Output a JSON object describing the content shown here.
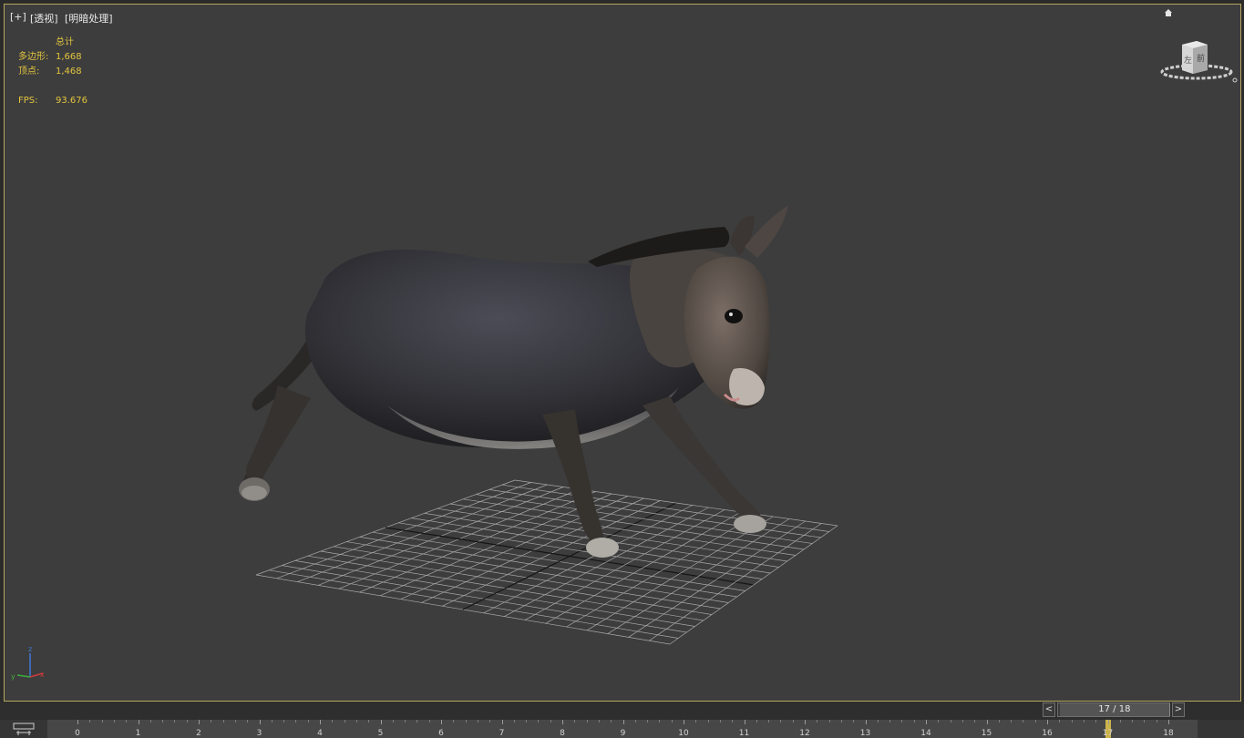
{
  "viewport": {
    "labels": [
      "[+]",
      "[透视]",
      "[明暗处理]"
    ],
    "stats": {
      "header": "总计",
      "polygons_label": "多边形:",
      "polygons_value": "1,668",
      "vertices_label": "顶点:",
      "vertices_value": "1,468",
      "fps_label": "FPS:",
      "fps_value": "93.676"
    },
    "viewcube": {
      "front_face": "左",
      "side_face": "前"
    },
    "axis_gizmo": {
      "x": "x",
      "y": "y",
      "z": "z"
    }
  },
  "time_slider": {
    "prev_label": "<",
    "next_label": ">",
    "current_frame": 17,
    "total_frames": 18,
    "display": "17 / 18"
  },
  "trackbar": {
    "frame_labels": [
      "0",
      "1",
      "2",
      "3",
      "4",
      "5",
      "6",
      "7",
      "8",
      "9",
      "10",
      "11",
      "12",
      "13",
      "14",
      "15",
      "16",
      "17",
      "18"
    ],
    "key_frame": 17
  },
  "colors": {
    "viewport_bg": "#3d3d3d",
    "active_border": "#b5a55e",
    "stats_text": "#e3c53f",
    "key_marker": "#cbb34b"
  }
}
